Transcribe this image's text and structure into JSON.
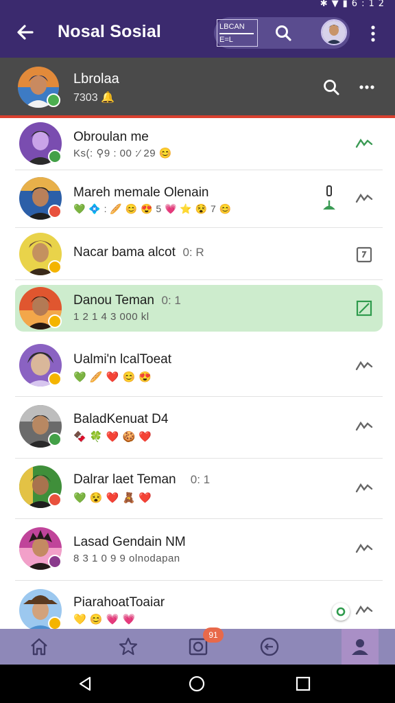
{
  "status_bar": {
    "time": "6:12"
  },
  "app_bar": {
    "title": "Nosal Sosial",
    "badge_line1": "LBCAN",
    "badge_line2": "E=L"
  },
  "profile": {
    "name": "Lbrolaa",
    "subtitle": "7303 🔔"
  },
  "chats": [
    {
      "title": "Obroulan me",
      "subtitle": "Ks(: ⚲9 : 00 :⁄ 29 😊",
      "badge_color": "#43a047",
      "avatar_colors": [
        "#7a4db0",
        "#c9a3e8",
        "#2b2b2b"
      ]
    },
    {
      "title": "Mareh memale Olenain",
      "subtitle": "💚 💠 : 🥖 😊 😍 5 💗 ⭐ 😵 7 😊",
      "badge_color": "#e8513d",
      "avatar_colors": [
        "#2c5fa8",
        "#e8b04a",
        "#1f1f1f"
      ]
    },
    {
      "title": "Nacar bama alcot",
      "time": "0: R",
      "subtitle": "",
      "badge_color": "#f4b400",
      "avatar_colors": [
        "#e9d34a",
        "#b79230",
        "#3a2a1a"
      ]
    },
    {
      "title": "Danou Teman",
      "time": "0: 1",
      "subtitle": "1 2 1 4 3 000 kl",
      "badge_color": "#f4b400",
      "avatar_colors": [
        "#e0562f",
        "#f3a74a",
        "#2a1a12"
      ],
      "highlight": true
    },
    {
      "title": "Ualmi'n lcalToeat",
      "subtitle": "💚 🥖 ❤️ 😊 😍",
      "badge_color": "#f4b400",
      "avatar_colors": [
        "#8a62c2",
        "#d7c6ef",
        "#2b2b2b"
      ]
    },
    {
      "title": "BaladKenuat D4",
      "subtitle": "🍫 🍀 ❤️ 🍪 ❤️",
      "badge_color": "#43a047",
      "avatar_colors": [
        "#6b6b6b",
        "#bdbdbd",
        "#2a2a2a"
      ]
    },
    {
      "title": "Dalrar laet Teman",
      "time": "0: 1",
      "subtitle": "💚 😵 ❤️ 🧸 ❤️",
      "badge_color": "#e8513d",
      "avatar_colors": [
        "#3f8f3a",
        "#e3c245",
        "#1e1e1e"
      ]
    },
    {
      "title": "Lasad Gendain NM",
      "subtitle": "8 3 1 0 9 9 olnodapan",
      "badge_color": "#8a3a8c",
      "avatar_colors": [
        "#c0449a",
        "#f2a0c9",
        "#251a1a"
      ]
    },
    {
      "title": "PiarahoatToaiar",
      "subtitle": "💛 😊 💗 💗",
      "badge_color": "#f4b400",
      "avatar_colors": [
        "#4b8fd1",
        "#9cc8ef",
        "#5a3a20"
      ]
    }
  ],
  "colors": {
    "primary": "#3b2a6e",
    "accent_red": "#d9402f",
    "online_green": "#4caf50",
    "highlight": "#cdeccd",
    "nav_bg": "#8e88b8"
  },
  "bottom_nav": {
    "items": [
      "home-icon",
      "star-icon",
      "camera-icon",
      "chat-icon",
      "person-icon"
    ],
    "badge": "91"
  }
}
